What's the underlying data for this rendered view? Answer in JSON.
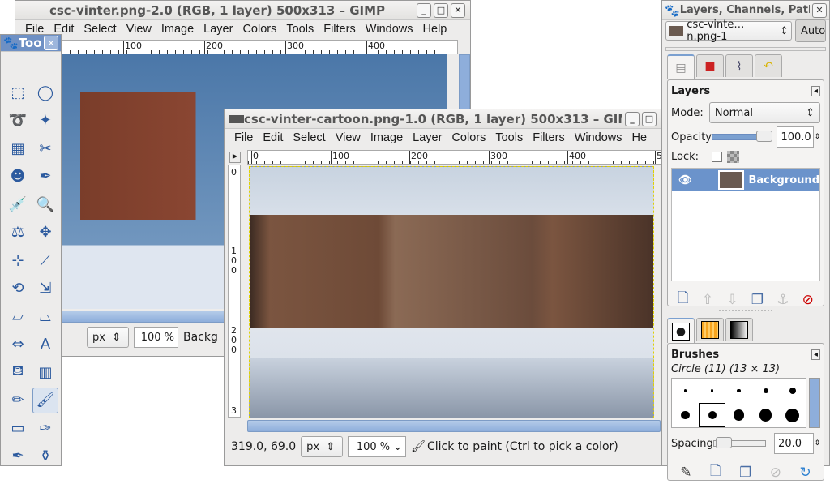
{
  "window1": {
    "title": "csc-vinter.png-2.0 (RGB, 1 layer) 500x313 – GIMP",
    "menu": [
      "File",
      "Edit",
      "Select",
      "View",
      "Image",
      "Layer",
      "Colors",
      "Tools",
      "Filters",
      "Windows",
      "Help"
    ],
    "ruler": [
      "100",
      "200",
      "300",
      "400"
    ],
    "unit": "px",
    "zoom": "100 %",
    "status": "Backg"
  },
  "toolbox": {
    "title": "Tooll",
    "tools": [
      "rect-select",
      "ellipse-select",
      "free-select",
      "fuzzy-select",
      "select-by-color",
      "scissors",
      "foreground-select",
      "paths",
      "color-picker",
      "zoom",
      "measure",
      "move",
      "align",
      "crop",
      "rotate",
      "scale",
      "shear",
      "perspective",
      "flip",
      "text",
      "bucket-fill",
      "blend",
      "pencil",
      "paintbrush",
      "eraser",
      "airbrush",
      "ink",
      "clone"
    ]
  },
  "window2": {
    "title": "csc-vinter-cartoon.png-1.0 (RGB, 1 layer) 500x313 – GIMP",
    "menu": [
      "File",
      "Edit",
      "Select",
      "View",
      "Image",
      "Layer",
      "Colors",
      "Tools",
      "Filters",
      "Windows",
      "He"
    ],
    "ruler": [
      "0",
      "100",
      "200",
      "300",
      "400",
      "5"
    ],
    "vruler": [
      "0",
      "1 0 0",
      "2 0 0",
      "3"
    ],
    "coords": "319.0, 69.0",
    "unit": "px",
    "zoom": "100 %",
    "status": "Click to paint (Ctrl to pick a color)"
  },
  "dock": {
    "title": "Layers, Channels, Paths,",
    "image_select": "csc-vinte…n.png-1",
    "auto": "Auto",
    "layers": {
      "heading": "Layers",
      "mode_label": "Mode:",
      "mode": "Normal",
      "opacity_label": "Opacity:",
      "opacity": "100.0",
      "opacity_fraction": 1.0,
      "lock_label": "Lock:",
      "items": [
        {
          "name": "Background",
          "visible": true
        }
      ]
    },
    "brushes": {
      "heading": "Brushes",
      "selected": "Circle (11) (13 × 13)",
      "spacing_label": "Spacing:",
      "spacing": "20.0"
    },
    "accent": "#6b93cb"
  }
}
